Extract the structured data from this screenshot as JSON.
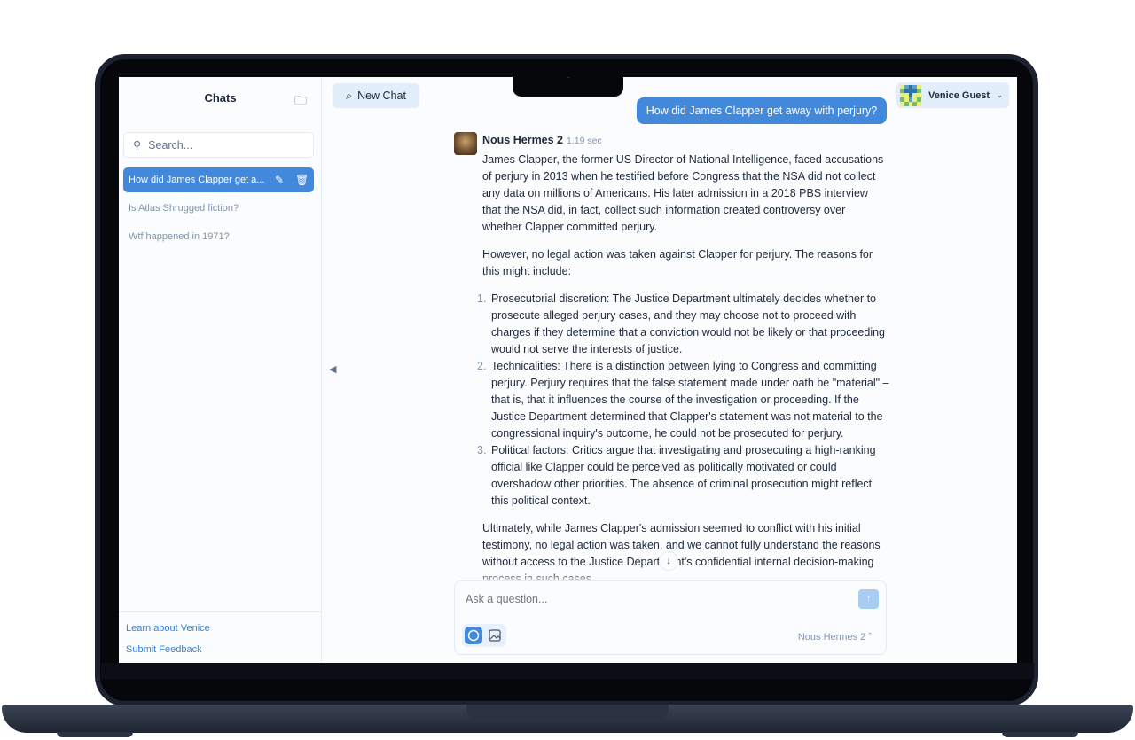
{
  "sidebar": {
    "title": "Chats",
    "search_placeholder": "Search...",
    "items": [
      {
        "label": "How did James Clapper get a..."
      },
      {
        "label": "Is Atlas Shrugged fiction?"
      },
      {
        "label": "Wtf happened in 1971?"
      }
    ],
    "footer": {
      "learn": "Learn about Venice",
      "feedback": "Submit Feedback"
    }
  },
  "header": {
    "new_chat": "New Chat",
    "user": "Venice Guest"
  },
  "chat": {
    "user_message": "How did James Clapper get away with perjury?",
    "bot_name": "Nous Hermes 2",
    "bot_time": "1.19 sec",
    "p1": "James Clapper, the former US Director of National Intelligence, faced accusations of perjury in 2013 when he testified before Congress that the NSA did not collect any data on millions of Americans. His later admission in a 2018 PBS interview that the NSA did, in fact, collect such information created controversy over whether Clapper committed perjury.",
    "p2": "However, no legal action was taken against Clapper for perjury. The reasons for this might include:",
    "list": [
      {
        "n": "1.",
        "text": "Prosecutorial discretion: The Justice Department ultimately decides whether to prosecute alleged perjury cases, and they may choose not to proceed with charges if they determine that a conviction would not be likely or that proceeding would not serve the interests of justice."
      },
      {
        "n": "2.",
        "text": "Technicalities: There is a distinction between lying to Congress and committing perjury. Perjury requires that the false statement made under oath be \"material\" – that is, that it influences the course of the investigation or proceeding. If the Justice Department determined that Clapper's statement was not material to the congressional inquiry's outcome, he could not be prosecuted for perjury."
      },
      {
        "n": "3.",
        "text": "Political factors: Critics argue that investigating and prosecuting a high-ranking official like Clapper could be perceived as politically motivated or could overshadow other priorities. The absence of criminal prosecution might reflect this political context."
      }
    ],
    "p3": "Ultimately, while James Clapper's admission seemed to conflict with his initial testimony, no legal action was taken, and we cannot fully understand the reasons without access to the Justice Department's confidential internal decision-making process in such cases."
  },
  "composer": {
    "placeholder": "Ask a question...",
    "model": "Nous Hermes 2"
  },
  "colors": {
    "accent": "#4289dc",
    "accent_light": "#e2eefa"
  }
}
